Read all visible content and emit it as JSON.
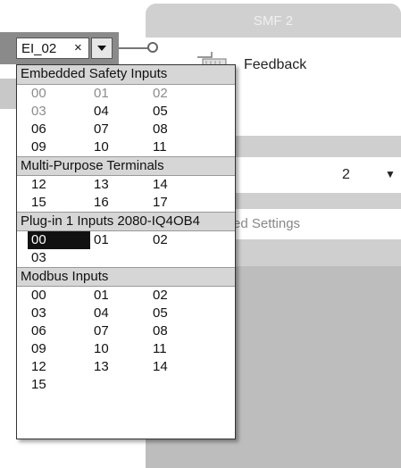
{
  "panel": {
    "title": "SMF 2",
    "feedback_label": "Feedback",
    "select_value": "2",
    "advanced_label": "ed Settings"
  },
  "combo": {
    "value": "EI_02",
    "clear_glyph": "×"
  },
  "dropdown": {
    "groups": [
      {
        "header": "Embedded Safety Inputs",
        "rows": [
          [
            {
              "label": "00",
              "state": "used"
            },
            {
              "label": "01",
              "state": "used"
            },
            {
              "label": "02",
              "state": "used"
            }
          ],
          [
            {
              "label": "03",
              "state": "used"
            },
            {
              "label": "04",
              "state": "normal"
            },
            {
              "label": "05",
              "state": "normal"
            }
          ],
          [
            {
              "label": "06",
              "state": "normal"
            },
            {
              "label": "07",
              "state": "normal"
            },
            {
              "label": "08",
              "state": "normal"
            }
          ],
          [
            {
              "label": "09",
              "state": "normal"
            },
            {
              "label": "10",
              "state": "normal"
            },
            {
              "label": "11",
              "state": "normal"
            }
          ]
        ]
      },
      {
        "header": "Multi-Purpose Terminals",
        "rows": [
          [
            {
              "label": "12",
              "state": "normal"
            },
            {
              "label": "13",
              "state": "normal"
            },
            {
              "label": "14",
              "state": "normal"
            }
          ],
          [
            {
              "label": "15",
              "state": "normal"
            },
            {
              "label": "16",
              "state": "normal"
            },
            {
              "label": "17",
              "state": "normal"
            }
          ]
        ]
      },
      {
        "header": "Plug-in 1 Inputs 2080-IQ4OB4",
        "rows": [
          [
            {
              "label": "00",
              "state": "selected"
            },
            {
              "label": "01",
              "state": "normal"
            },
            {
              "label": "02",
              "state": "normal"
            }
          ],
          [
            {
              "label": "03",
              "state": "normal"
            }
          ]
        ]
      },
      {
        "header": "Modbus Inputs",
        "rows": [
          [
            {
              "label": "00",
              "state": "normal"
            },
            {
              "label": "01",
              "state": "normal"
            },
            {
              "label": "02",
              "state": "normal"
            }
          ],
          [
            {
              "label": "03",
              "state": "normal"
            },
            {
              "label": "04",
              "state": "normal"
            },
            {
              "label": "05",
              "state": "normal"
            }
          ],
          [
            {
              "label": "06",
              "state": "normal"
            },
            {
              "label": "07",
              "state": "normal"
            },
            {
              "label": "08",
              "state": "normal"
            }
          ],
          [
            {
              "label": "09",
              "state": "normal"
            },
            {
              "label": "10",
              "state": "normal"
            },
            {
              "label": "11",
              "state": "normal"
            }
          ],
          [
            {
              "label": "12",
              "state": "normal"
            },
            {
              "label": "13",
              "state": "normal"
            },
            {
              "label": "14",
              "state": "normal"
            }
          ],
          [
            {
              "label": "15",
              "state": "normal"
            }
          ]
        ]
      }
    ]
  },
  "icons": {
    "feedback": "feedback-block-icon",
    "dropdown_caret": "chevron-down-icon",
    "select_caret": "chevron-down-icon"
  },
  "colors": {
    "selected_bg": "#111111",
    "used_text": "#8c8c8c",
    "group_header_bg": "#d6d6d6"
  }
}
